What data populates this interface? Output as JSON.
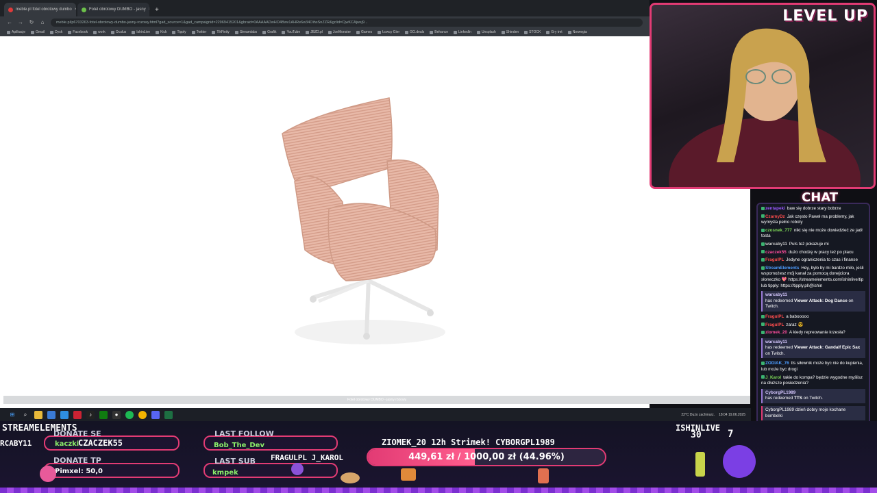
{
  "browser": {
    "tabs": [
      {
        "label": "meble.pl fotel obrotowy dumbo",
        "active": true
      },
      {
        "label": "Fotel obrotowy DUMBO - jasny",
        "active": false
      }
    ],
    "new_tab": "+",
    "url": "meble.pl/p6703263-fotel-obrotowy-dumbo-jasny-rozowy.html?gad_source=1&gad_campaignid=22969415201&gbraid=0AAAAADwHO4Bwv1AHRe6w34OihsSnZZR&gclid=CjwKCAjwsj9...",
    "bookmarks": [
      "Aplikacje",
      "Gmail",
      "Dysk",
      "Facebook",
      "work",
      "Oculus",
      "IshinLive",
      "Kick",
      "Tipply",
      "Twitter",
      "TikFinity",
      "Streamlabs",
      "Grafik",
      "YouTube",
      "JBZD.pl",
      "JoeMonster",
      "Games",
      "Łowcy Gier",
      "GG.deals",
      "Behance",
      "LinkedIn",
      "Unsplash",
      "Shinden",
      "STOCK",
      "Gry tmt",
      "Norwegia"
    ],
    "image_caption": "Fotel obrotowy DUMBO - jasny różowy",
    "tray_weather": "22°C Dużo zachmurz.",
    "tray_time": "18:04",
    "tray_date": "19.06.2025"
  },
  "webcam": {
    "logo": "LEVEL UP"
  },
  "chat": {
    "title": "CHAT",
    "messages": [
      {
        "user": "zentapeki",
        "text": "baw się dobrze stary bobrze",
        "color": "#9b59ff"
      },
      {
        "user": "CzarnyDz",
        "text": "Jak często Paweł ma problemy, jak wymyśla pełno roboty",
        "color": "#ff4d4d"
      },
      {
        "user": "czosnek_777",
        "text": "nikt się nie może dowiedzieć ze jadł tosta",
        "color": "#7ed957"
      },
      {
        "user": "warcaby11",
        "text": "Puls też pokazuje mi",
        "color": "#c8c8c8"
      },
      {
        "user": "czaczek55",
        "text": "dużo chodzę w pracy też po placu",
        "color": "#ff4d9d"
      },
      {
        "user": "FragulPL",
        "text": "Jedyne ograniczenia to czas i finanse",
        "color": "#ff4d4d"
      },
      {
        "user": "StreamElements",
        "text": "Hey, było by mi bardzo miło, jeśli wspomożesz mój kanał za pomocą donejciora słoneczko 💖 https://streamelements.com/ishinlive/tip lub tipply: https://tipply.pl/@ishin",
        "color": "#4d9dff"
      }
    ],
    "redeem1": {
      "user": "warcaby11",
      "text_pre": "has redeemed ",
      "reward": "Viewer Attack: Dog Dance",
      "text_post": " on Twitch."
    },
    "messages2": [
      {
        "user": "FragulPL",
        "text": "a babooooo",
        "color": "#ff4d4d"
      },
      {
        "user": "FragulPL",
        "text": "zaraz 😎",
        "color": "#ff4d4d"
      },
      {
        "user": "ziomek_20",
        "text": "A kiedy repreowanie krzesła?",
        "color": "#ff4d9d"
      }
    ],
    "redeem2": {
      "user": "warcaby11",
      "text_pre": "has redeemed ",
      "reward": "Viewer Attack: Gandalf Epic Sax",
      "text_post": " on Twitch."
    },
    "messages3": [
      {
        "user": "ZODIAK_76",
        "text": "tts siłownik może byc nie do kupienia, lub może byc drogi",
        "color": "#4d9dff"
      },
      {
        "user": "J_Karol",
        "text": "takie do kompa? będzie wygodne myślisz na dłuższe posiedzenia?",
        "color": "#7ed957"
      }
    ],
    "redeem3": {
      "user": "CyborgPL1989",
      "text_pre": "has redeemed ",
      "reward": "TTS",
      "text_post": " on Twitch."
    },
    "redeem3_msg": "CyborgPL1989  dzień dobry moje kochane bombelki"
  },
  "overlay": {
    "brand": "STREAMELEMENTS",
    "scroll_name": "RCABY11",
    "donate_se_label": "DONATE SE",
    "donate_se_value": "kaczki",
    "donate_se_value2": "CZACZEK55",
    "donate_tp_label": "DONATE TP",
    "donate_tp_value": "Pimxel: 50,0",
    "last_follow_label": "LAST FOLLOW",
    "last_follow_value": "Bob_The_Dev",
    "last_sub_label": "LAST SUB",
    "last_sub_value": "kmpek",
    "names_row": "FRAGULPL  J_KAROL",
    "ticker": "ZIOMEK_20  12h Strimek!  CYBORGPL1989",
    "goal_text": "449,61 zł / 1000,00 zł (44.96%)",
    "goal_fraction": 0.4496,
    "channel": "ISHINLIVE",
    "count_left": "30",
    "count_right": "7"
  },
  "colors": {
    "accent": "#e23b74",
    "chat_bg": "#151822",
    "overlay_bg": "#141324"
  }
}
